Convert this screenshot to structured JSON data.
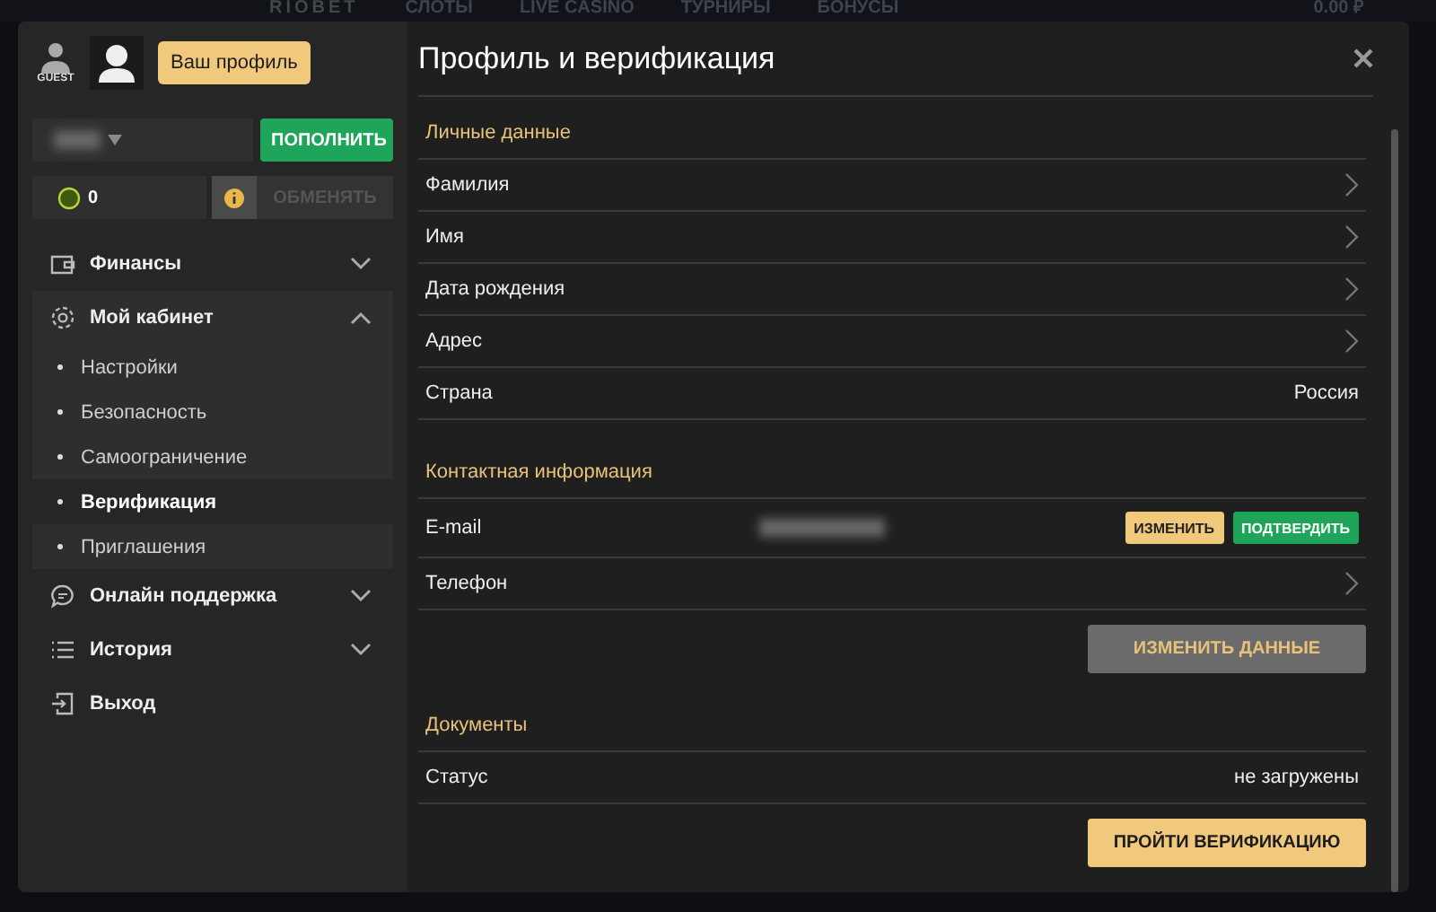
{
  "site_nav": {
    "logo": "RIOBET",
    "items": [
      "СЛОТЫ",
      "LIVE CASINO",
      "ТУРНИРЫ",
      "БОНУСЫ"
    ],
    "balance": "0.00 ₽"
  },
  "sidebar": {
    "guest_label": "GUEST",
    "profile_tooltip": "Ваш профиль",
    "deposit_button": "ПОПОЛНИТЬ",
    "points": "0",
    "exchange_button": {
      "label": "ОБМЕНЯТЬ",
      "disabled": true
    },
    "menu": [
      {
        "label": "Финансы",
        "kind": "wallet",
        "expanded": false
      },
      {
        "label": "Мой кабинет",
        "kind": "gear",
        "expanded": true,
        "children": [
          {
            "label": "Настройки",
            "selected": false
          },
          {
            "label": "Безопасность",
            "selected": false
          },
          {
            "label": "Самоограничение",
            "selected": false
          },
          {
            "label": "Верификация",
            "selected": true
          },
          {
            "label": "Приглашения",
            "selected": false
          }
        ]
      },
      {
        "label": "Онлайн поддержка",
        "kind": "chat",
        "expanded": false
      },
      {
        "label": "История",
        "kind": "list",
        "expanded": false
      },
      {
        "label": "Выход",
        "kind": "exit"
      }
    ]
  },
  "main": {
    "title": "Профиль и верификация",
    "sections": [
      {
        "title": "Личные данные",
        "rows": [
          {
            "kind": "link",
            "label": "Фамилия"
          },
          {
            "kind": "link",
            "label": "Имя"
          },
          {
            "kind": "link",
            "label": "Дата рождения"
          },
          {
            "kind": "link",
            "label": "Адрес"
          },
          {
            "kind": "value",
            "label": "Страна",
            "value": "Россия"
          }
        ]
      },
      {
        "title": "Контактная информация",
        "rows": [
          {
            "kind": "email",
            "label": "E-mail",
            "buttons": [
              {
                "label": "ИЗМЕНИТЬ",
                "kind": "edit"
              },
              {
                "label": "ПОДТВЕРДИТЬ",
                "kind": "confirm"
              }
            ]
          },
          {
            "kind": "link",
            "label": "Телефон"
          }
        ],
        "action": {
          "label": "ИЗМЕНИТЬ ДАННЫЕ",
          "disabled": true
        }
      },
      {
        "title": "Документы",
        "rows": [
          {
            "kind": "value",
            "label": "Статус",
            "value": "не загружены"
          }
        ],
        "action": {
          "label": "ПРОЙТИ ВЕРИФИКАЦИЮ",
          "disabled": false
        }
      }
    ]
  }
}
